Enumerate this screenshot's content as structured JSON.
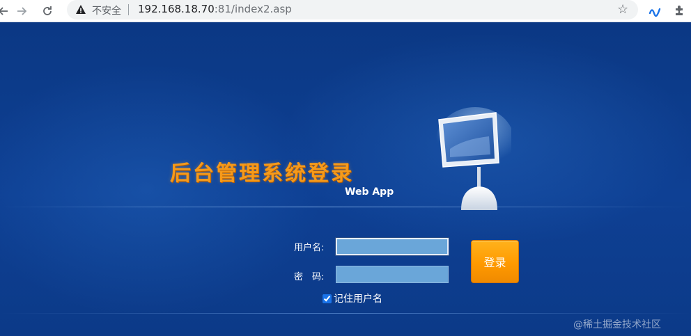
{
  "browser": {
    "security_label": "不安全",
    "url_host": "192.168.18.70",
    "url_rest": ":81/index2.asp"
  },
  "login": {
    "title": "后台管理系统登录",
    "subtitle": "Web App",
    "username_label": "用户名:",
    "password_label": "密　码:",
    "username_value": "",
    "password_value": "",
    "login_button": "登录",
    "remember_label": "记住用户名",
    "remember_checked": true
  },
  "watermark": "@稀土掘金技术社区",
  "colors": {
    "background": "#0d3a86",
    "title": "#f59a1b",
    "button": "#ff9a00",
    "input": "#6aa6d9"
  }
}
